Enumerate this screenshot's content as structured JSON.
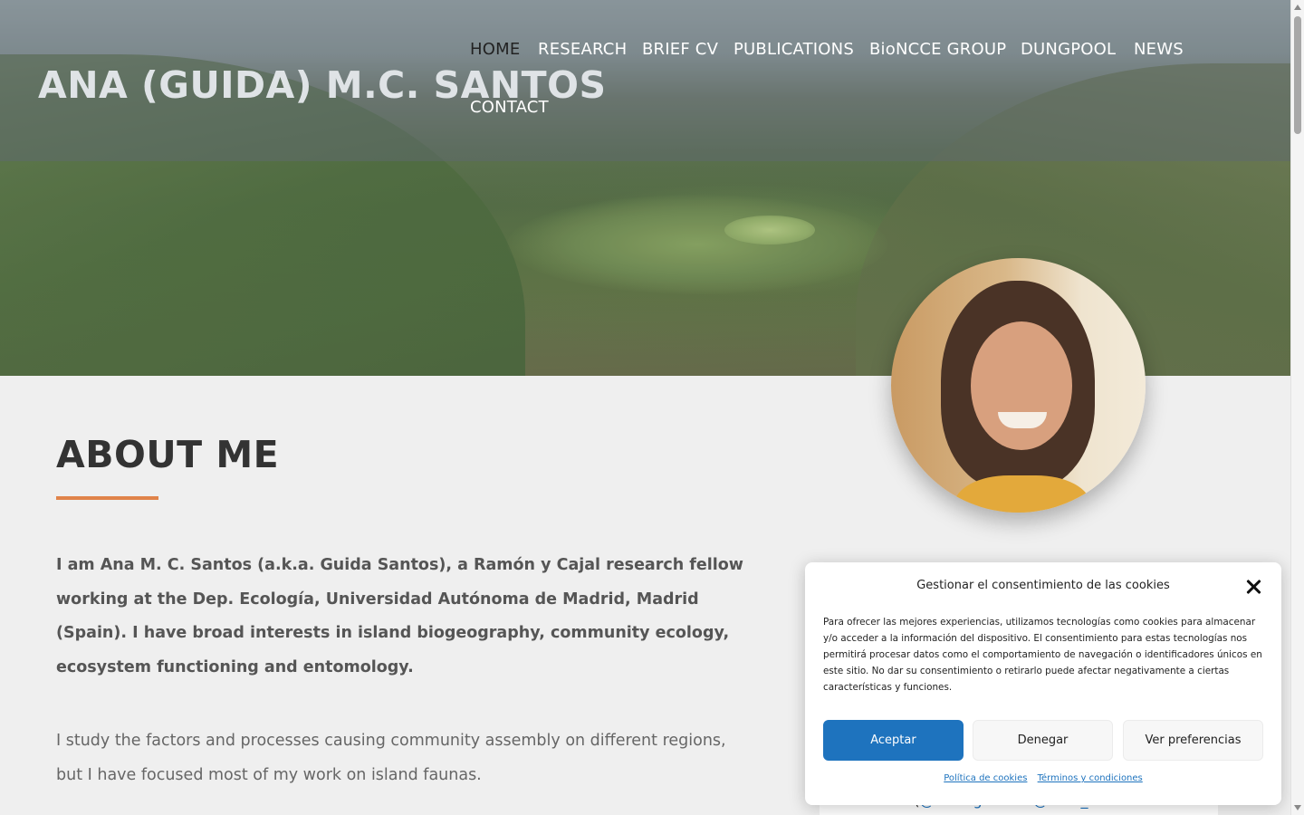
{
  "site": {
    "title": "ANA (GUIDA) M.C. SANTOS"
  },
  "nav": {
    "items": [
      {
        "label": "HOME",
        "active": true
      },
      {
        "label": "RESEARCH"
      },
      {
        "label": "BRIEF CV"
      },
      {
        "label": "PUBLICATIONS"
      },
      {
        "label": "BioNCCE GROUP"
      },
      {
        "label": "DUNGPOOL"
      },
      {
        "label": "NEWS"
      },
      {
        "label": "CONTACT"
      }
    ]
  },
  "about": {
    "heading": "ABOUT ME",
    "intro_bold": "I am Ana M. C. Santos (a.k.a. Guida Santos), a Ramón y Cajal research fellow working at the Dep. Ecología, Universidad Autónoma de Madrid, Madrid (Spain). I have broad interests in island biogeography, community ecology, ecosystem functioning and entomology.",
    "intro_normal": "I study the factors and processes causing community assembly on different regions, but I have focused most of my work on island faunas."
  },
  "sidebar": {
    "follow_prefix": "Follow (",
    "follow_handles": "@EcologiaUam @UAM_Madrid"
  },
  "cookie": {
    "title": "Gestionar el consentimiento de las cookies",
    "body": "Para ofrecer las mejores experiencias, utilizamos tecnologías como cookies para almacenar y/o acceder a la información del dispositivo. El consentimiento para estas tecnologías nos permitirá procesar datos como el comportamiento de navegación o identificadores únicos en este sitio. No dar su consentimiento o retirarlo puede afectar negativamente a ciertas características y funciones.",
    "accept_label": "Aceptar",
    "deny_label": "Denegar",
    "prefs_label": "Ver preferencias",
    "policy_link": "Política de cookies",
    "terms_link": "Términos y condiciones"
  },
  "colors": {
    "accent": "#e0834a",
    "button_primary": "#1e73be",
    "heading": "#333333"
  }
}
